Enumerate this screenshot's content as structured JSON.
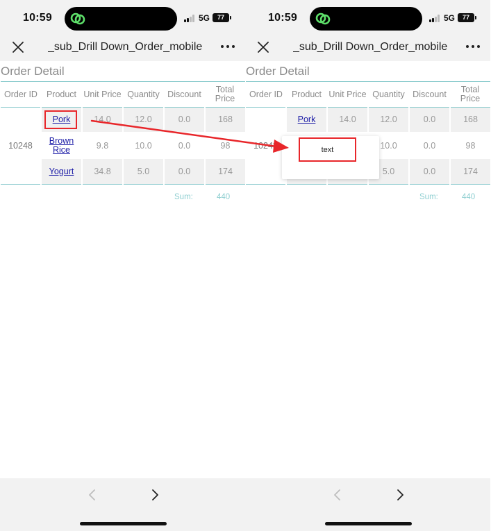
{
  "status": {
    "time": "10:59",
    "network": "5G",
    "battery": "77"
  },
  "header": {
    "page_name": "_sub_Drill Down_Order_mobile"
  },
  "report": {
    "title": "Order Detail",
    "columns": [
      "Order ID",
      "Product",
      "Unit Price",
      "Quantity",
      "Discount",
      "Total Price"
    ],
    "order_id": "10248",
    "rows": [
      {
        "product": "Pork",
        "unit_price": "14.0",
        "quantity": "12.0",
        "discount": "0.0",
        "total": "168"
      },
      {
        "product": "Brown Rice",
        "unit_price": "9.8",
        "quantity": "10.0",
        "discount": "0.0",
        "total": "98"
      },
      {
        "product": "Yogurt",
        "unit_price": "34.8",
        "quantity": "5.0",
        "discount": "0.0",
        "total": "174"
      }
    ],
    "sum_label": "Sum:",
    "sum_value": "440"
  },
  "popup": {
    "text": "text"
  },
  "colors": {
    "accent_line": "#87c9cc",
    "link": "#1a1aa6",
    "annotation": "#e8262a"
  },
  "icons": [
    "close-icon",
    "more-icon",
    "chevron-left-icon",
    "chevron-right-icon",
    "app-logo-icon"
  ]
}
